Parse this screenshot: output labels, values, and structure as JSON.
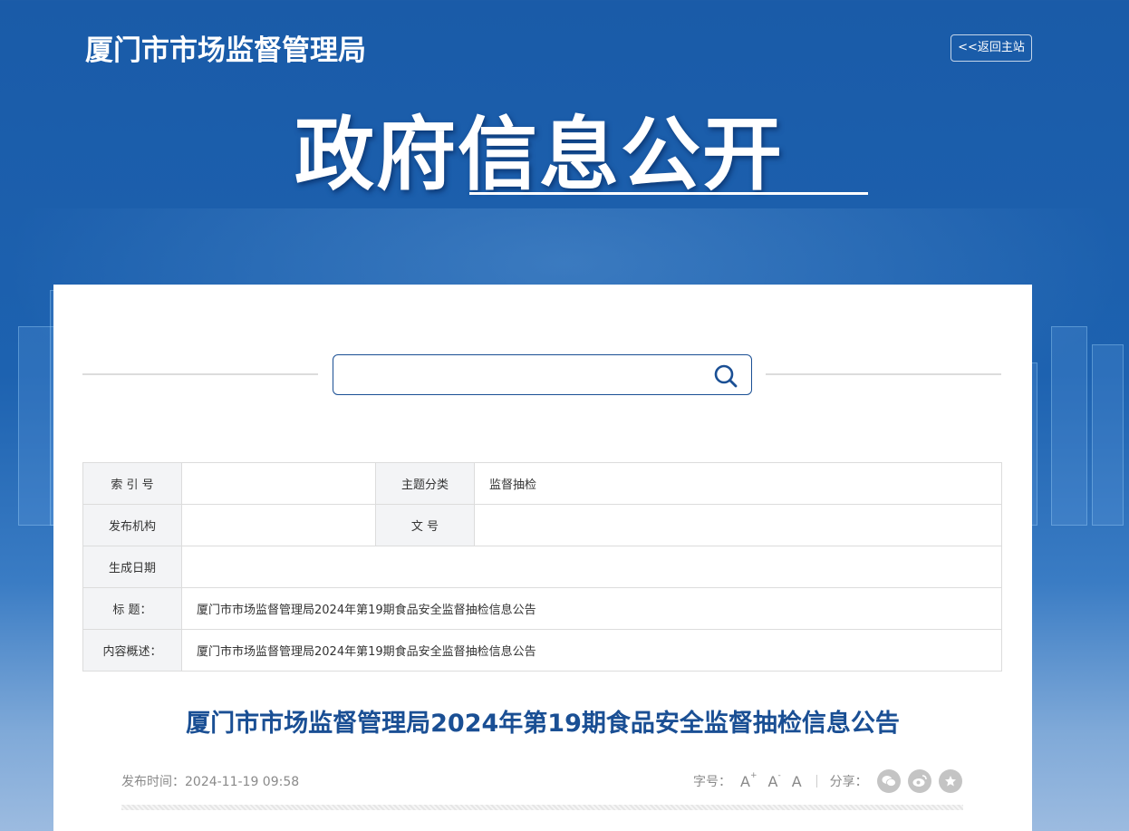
{
  "header": {
    "site_title": "厦门市市场监督管理局",
    "back_label": "<<返回主站",
    "hero_title": "政府信息公开"
  },
  "search": {
    "value": "",
    "placeholder": ""
  },
  "meta_table": {
    "index_label": "索 引 号",
    "index_value": "",
    "topic_label": "主题分类",
    "topic_value": "监督抽检",
    "publisher_label": "发布机构",
    "publisher_value": "",
    "doc_no_label": "文 号",
    "doc_no_value": "",
    "date_label": "生成日期",
    "date_value": "",
    "title_label": "标 题：",
    "title_value": "厦门市市场监督管理局2024年第19期食品安全监督抽检信息公告",
    "summary_label": "内容概述：",
    "summary_value": "厦门市市场监督管理局2024年第19期食品安全监督抽检信息公告"
  },
  "article": {
    "title": "厦门市市场监督管理局2024年第19期食品安全监督抽检信息公告",
    "publish_time": "发布时间：2024-11-19 09:58",
    "font_size_label": "字号：",
    "font_large": "A",
    "font_small": "A",
    "font_normal": "A",
    "share_label": "分享："
  },
  "icons": {
    "search": "search-icon",
    "wechat": "wechat-icon",
    "weibo": "weibo-icon",
    "favorite": "star-icon"
  },
  "colors": {
    "brand_blue": "#1a4f94",
    "header_bg": "#1a5ba8"
  }
}
